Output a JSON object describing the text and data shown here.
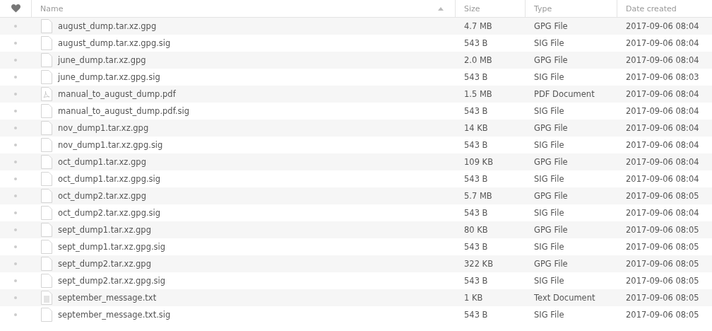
{
  "table": {
    "columns": [
      {
        "label": "Name",
        "sorted": true
      },
      {
        "label": "Size",
        "sorted": false
      },
      {
        "label": "Type",
        "sorted": false
      },
      {
        "label": "Date created",
        "sorted": false
      }
    ],
    "rows": [
      {
        "kind": "file",
        "name": "august_dump.tar.xz.gpg",
        "size": "4.7 MB",
        "type": "GPG File",
        "date": "2017-09-06 08:04"
      },
      {
        "kind": "file",
        "name": "august_dump.tar.xz.gpg.sig",
        "size": "543 B",
        "type": "SIG File",
        "date": "2017-09-06 08:04"
      },
      {
        "kind": "file",
        "name": "june_dump.tar.xz.gpg",
        "size": "2.0 MB",
        "type": "GPG File",
        "date": "2017-09-06 08:04"
      },
      {
        "kind": "file",
        "name": "june_dump.tar.xz.gpg.sig",
        "size": "543 B",
        "type": "SIG File",
        "date": "2017-09-06 08:03"
      },
      {
        "kind": "pdf",
        "name": "manual_to_august_dump.pdf",
        "size": "1.5 MB",
        "type": "PDF Document",
        "date": "2017-09-06 08:04"
      },
      {
        "kind": "file",
        "name": "manual_to_august_dump.pdf.sig",
        "size": "543 B",
        "type": "SIG File",
        "date": "2017-09-06 08:04"
      },
      {
        "kind": "file",
        "name": "nov_dump1.tar.xz.gpg",
        "size": "14 KB",
        "type": "GPG File",
        "date": "2017-09-06 08:04"
      },
      {
        "kind": "file",
        "name": "nov_dump1.tar.xz.gpg.sig",
        "size": "543 B",
        "type": "SIG File",
        "date": "2017-09-06 08:04"
      },
      {
        "kind": "file",
        "name": "oct_dump1.tar.xz.gpg",
        "size": "109 KB",
        "type": "GPG File",
        "date": "2017-09-06 08:04"
      },
      {
        "kind": "file",
        "name": "oct_dump1.tar.xz.gpg.sig",
        "size": "543 B",
        "type": "SIG File",
        "date": "2017-09-06 08:04"
      },
      {
        "kind": "file",
        "name": "oct_dump2.tar.xz.gpg",
        "size": "5.7 MB",
        "type": "GPG File",
        "date": "2017-09-06 08:05"
      },
      {
        "kind": "file",
        "name": "oct_dump2.tar.xz.gpg.sig",
        "size": "543 B",
        "type": "SIG File",
        "date": "2017-09-06 08:04"
      },
      {
        "kind": "file",
        "name": "sept_dump1.tar.xz.gpg",
        "size": "80 KB",
        "type": "GPG File",
        "date": "2017-09-06 08:05"
      },
      {
        "kind": "file",
        "name": "sept_dump1.tar.xz.gpg.sig",
        "size": "543 B",
        "type": "SIG File",
        "date": "2017-09-06 08:05"
      },
      {
        "kind": "file",
        "name": "sept_dump2.tar.xz.gpg",
        "size": "322 KB",
        "type": "GPG File",
        "date": "2017-09-06 08:05"
      },
      {
        "kind": "file",
        "name": "sept_dump2.tar.xz.gpg.sig",
        "size": "543 B",
        "type": "SIG File",
        "date": "2017-09-06 08:05"
      },
      {
        "kind": "text",
        "name": "september_message.txt",
        "size": "1 KB",
        "type": "Text Document",
        "date": "2017-09-06 08:05"
      },
      {
        "kind": "file",
        "name": "september_message.txt.sig",
        "size": "543 B",
        "type": "SIG File",
        "date": "2017-09-06 08:05"
      }
    ]
  }
}
